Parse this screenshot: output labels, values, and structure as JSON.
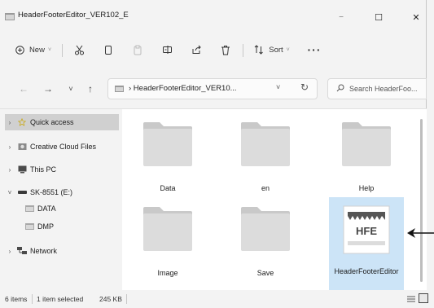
{
  "window": {
    "title": "HeaderFooterEditor_VER102_E",
    "minimize_glyph": "−",
    "maximize_glyph": "☐",
    "close_glyph": "✕"
  },
  "toolbar": {
    "new_label": "New",
    "new_chevron": "˅",
    "sort_label": "Sort",
    "sort_chevron": "˅",
    "more_glyph": "···",
    "icons": [
      "cut-icon",
      "copy-icon",
      "paste-icon",
      "rename-icon",
      "share-icon",
      "delete-icon",
      "sort-icon",
      "more-icon"
    ]
  },
  "address": {
    "back_glyph": "←",
    "forward_glyph": "→",
    "recent_glyph": "˅",
    "up_glyph": "↑",
    "breadcrumb": "›  HeaderFooterEditor_VER10...",
    "dropdown_glyph": "˅",
    "refresh_glyph": "↻",
    "search_placeholder": "Search HeaderFoo..."
  },
  "sidebar": {
    "items": [
      {
        "label": "Quick access",
        "chevron": "›",
        "icon": "star-icon"
      },
      {
        "label": "Creative Cloud Files",
        "chevron": "›",
        "icon": "creative-cloud-icon"
      },
      {
        "label": "This PC",
        "chevron": "›",
        "icon": "monitor-icon"
      },
      {
        "label": "SK-8551 (E:)",
        "chevron": "˅",
        "icon": "drive-icon"
      },
      {
        "label": "DATA",
        "chevron": "",
        "icon": "folder-icon"
      },
      {
        "label": "DMP",
        "chevron": "",
        "icon": "folder-icon"
      },
      {
        "label": "Network",
        "chevron": "›",
        "icon": "network-icon"
      }
    ]
  },
  "files": [
    {
      "name": "Data",
      "type": "folder"
    },
    {
      "name": "en",
      "type": "folder"
    },
    {
      "name": "Help",
      "type": "folder"
    },
    {
      "name": "Image",
      "type": "folder"
    },
    {
      "name": "Save",
      "type": "folder"
    },
    {
      "name": "HeaderFooterEditor",
      "type": "application",
      "icon_text": "HFE"
    }
  ],
  "status": {
    "count": "6 items",
    "selection": "1 item selected",
    "size": "245 KB"
  },
  "colors": {
    "selection": "#cce4f7",
    "folder_body": "#dcdcdc",
    "folder_tab": "#c9c9c9",
    "background": "#f3f3f3"
  }
}
